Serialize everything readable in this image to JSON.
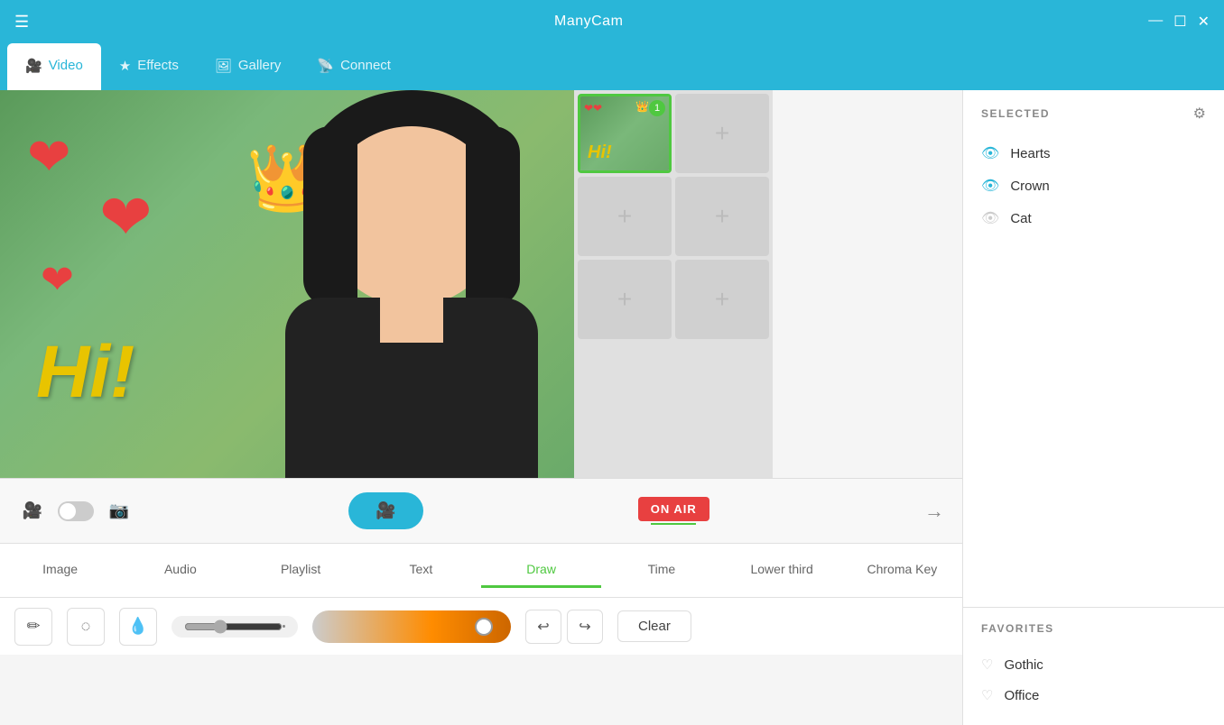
{
  "titlebar": {
    "title": "ManyCam",
    "menu_icon": "☰",
    "minimize": "—",
    "maximize": "☐",
    "close": "✕"
  },
  "tabs": [
    {
      "id": "video",
      "label": "Video",
      "icon": "🎥",
      "active": true
    },
    {
      "id": "effects",
      "label": "Effects",
      "icon": "★",
      "active": false
    },
    {
      "id": "gallery",
      "label": "Gallery",
      "icon": "🖼",
      "active": false
    },
    {
      "id": "connect",
      "label": "Connect",
      "icon": "📡",
      "active": false
    }
  ],
  "video_overlay": {
    "hi_text": "Hi!",
    "crown": "👑",
    "hearts": [
      "❤",
      "❤",
      "❤"
    ]
  },
  "thumbnail": {
    "badge": "1"
  },
  "controls": {
    "record_icon": "🎥",
    "on_air": "ON AIR",
    "camera_icon": "📷",
    "toggle_label": ""
  },
  "bottom_tabs": [
    {
      "id": "image",
      "label": "Image"
    },
    {
      "id": "audio",
      "label": "Audio"
    },
    {
      "id": "playlist",
      "label": "Playlist"
    },
    {
      "id": "text",
      "label": "Text"
    },
    {
      "id": "draw",
      "label": "Draw",
      "active": true
    },
    {
      "id": "time",
      "label": "Time"
    },
    {
      "id": "lower_third",
      "label": "Lower third"
    },
    {
      "id": "chroma_key",
      "label": "Chroma Key"
    }
  ],
  "draw_tools": {
    "pen_icon": "✏",
    "eraser_icon": "◌",
    "fill_icon": "💧",
    "undo_icon": "↩",
    "redo_icon": "↪",
    "clear_label": "Clear"
  },
  "right_panel": {
    "selected_title": "SELECTED",
    "filter_icon": "⚙",
    "effects": [
      {
        "id": "hearts",
        "label": "Hearts",
        "active": true
      },
      {
        "id": "crown",
        "label": "Crown",
        "active": true
      },
      {
        "id": "cat",
        "label": "Cat",
        "active": false
      }
    ],
    "favorites_title": "FAVORITES",
    "favorites": [
      {
        "id": "gothic",
        "label": "Gothic"
      },
      {
        "id": "office",
        "label": "Office"
      }
    ]
  }
}
